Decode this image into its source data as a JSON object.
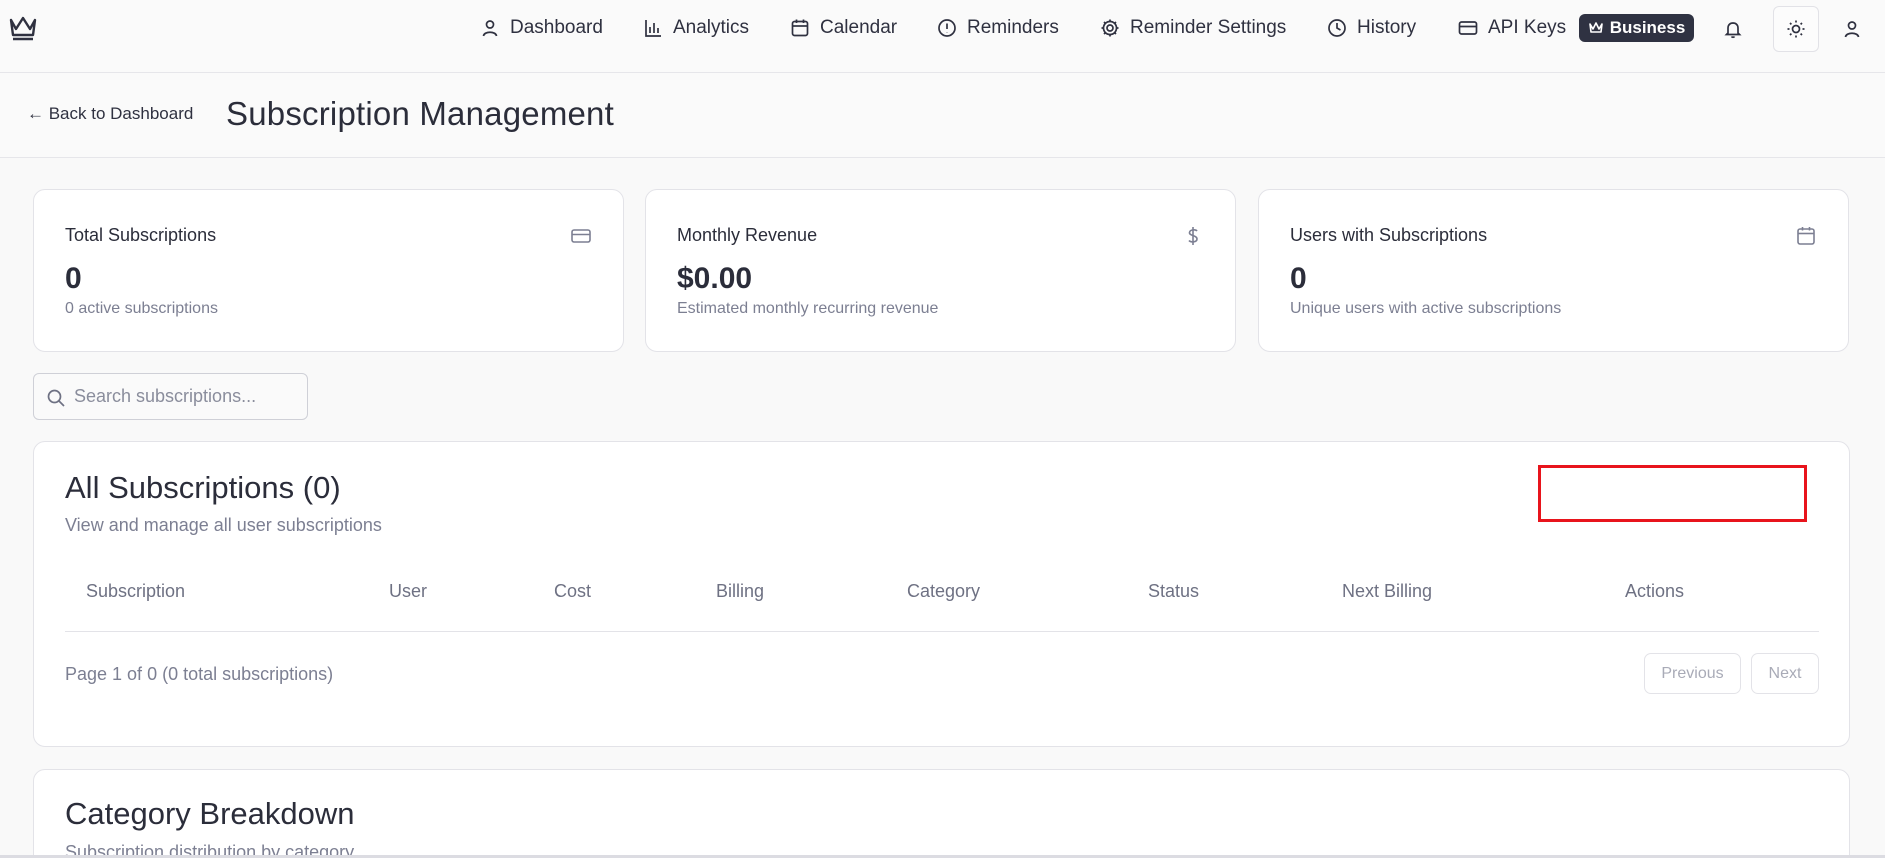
{
  "nav": {
    "items": [
      {
        "label": "Dashboard",
        "icon": "user-icon"
      },
      {
        "label": "Analytics",
        "icon": "bar-chart-icon"
      },
      {
        "label": "Calendar",
        "icon": "calendar-icon"
      },
      {
        "label": "Reminders",
        "icon": "alert-circle-icon"
      },
      {
        "label": "Reminder Settings",
        "icon": "gear-icon"
      },
      {
        "label": "History",
        "icon": "clock-icon"
      },
      {
        "label": "API Keys",
        "icon": "card-icon"
      }
    ],
    "plan_badge": "Business"
  },
  "header": {
    "back_label": "← Back to Dashboard",
    "title": "Subscription Management"
  },
  "stats": [
    {
      "label": "Total Subscriptions",
      "value": "0",
      "sub": "0 active subscriptions",
      "icon": "credit-card-icon"
    },
    {
      "label": "Monthly Revenue",
      "value": "$0.00",
      "sub": "Estimated monthly recurring revenue",
      "icon": "dollar-icon"
    },
    {
      "label": "Users with Subscriptions",
      "value": "0",
      "sub": "Unique users with active subscriptions",
      "icon": "calendar-icon"
    }
  ],
  "search": {
    "placeholder": "Search subscriptions..."
  },
  "subscriptions": {
    "title": "All Subscriptions (0)",
    "description": "View and manage all user subscriptions",
    "columns": [
      "Subscription",
      "User",
      "Cost",
      "Billing",
      "Category",
      "Status",
      "Next Billing",
      "Actions"
    ],
    "pagination_text": "Page 1 of 0 (0 total subscriptions)",
    "prev_label": "Previous",
    "next_label": "Next"
  },
  "category": {
    "title": "Category Breakdown",
    "description": "Subscription distribution by category"
  },
  "colors": {
    "accent_dark": "#2f3242",
    "highlight": "#e8141c"
  }
}
